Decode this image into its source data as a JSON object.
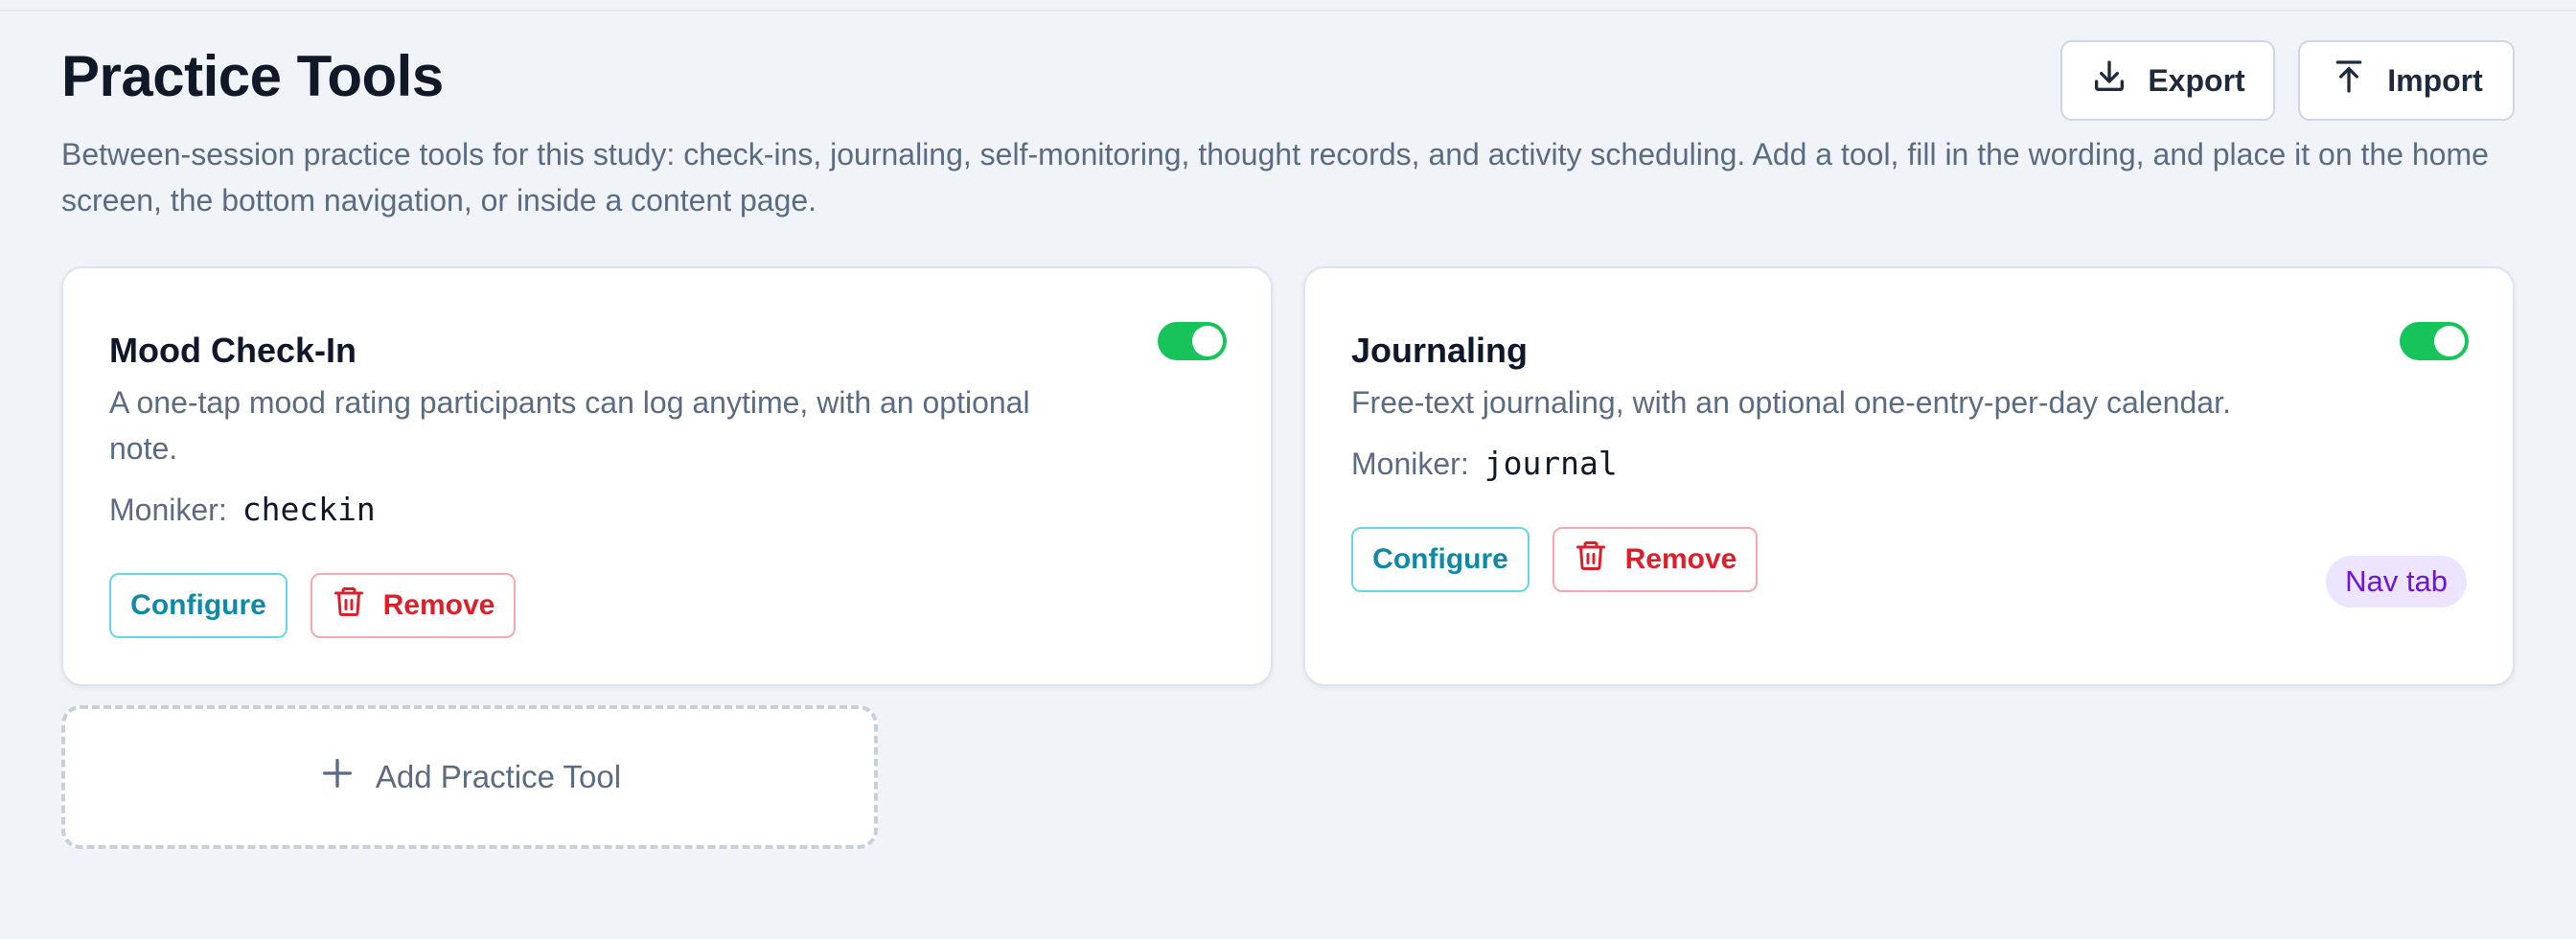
{
  "header": {
    "title": "Practice Tools",
    "subtitle": "Between-session practice tools for this study: check-ins, journaling, self-monitoring, thought records, and activity scheduling. Add a tool, fill in the wording, and place it on the home screen, the bottom navigation, or inside a content page.",
    "export_label": "Export",
    "export_icon": "download-icon",
    "import_label": "Import",
    "import_icon": "upload-icon"
  },
  "tools": [
    {
      "title": "Mood Check-In",
      "description": "A one-tap mood rating participants can log anytime, with an optional note.",
      "moniker_label": "Moniker:",
      "moniker": "checkin",
      "enabled": true,
      "configure_label": "Configure",
      "remove_label": "Remove",
      "remove_icon": "trash-icon"
    },
    {
      "title": "Journaling",
      "description": "Free-text journaling, with an optional one-entry-per-day calendar.",
      "moniker_label": "Moniker:",
      "moniker": "journal",
      "enabled": true,
      "configure_label": "Configure",
      "remove_label": "Remove",
      "remove_icon": "trash-icon",
      "badge": "Nav tab"
    }
  ],
  "add_tool": {
    "label": "Add Practice Tool",
    "icon": "plus-icon"
  },
  "colors": {
    "toggle_on": "#16c45a",
    "configure": "#0f8aa5",
    "remove": "#dc1f2b",
    "badge_text": "#6d16d8",
    "badge_bg": "#ede4ff"
  }
}
